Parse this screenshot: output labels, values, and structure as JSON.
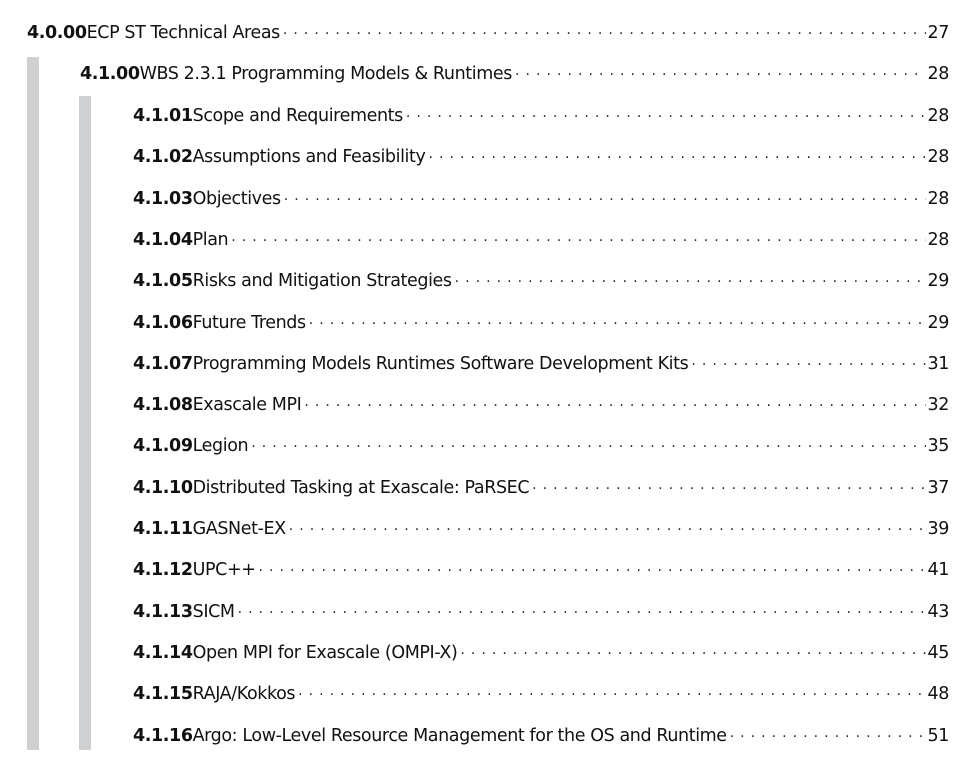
{
  "toc": {
    "level0": {
      "number": "4.0.00",
      "title": "ECP ST Technical Areas",
      "page": "27"
    },
    "level1": {
      "number": "4.1.00",
      "title": "WBS 2.3.1 Programming Models & Runtimes",
      "page": "28"
    },
    "entries": [
      {
        "number": "4.1.01",
        "title": "Scope and Requirements",
        "page": "28"
      },
      {
        "number": "4.1.02",
        "title": "Assumptions and Feasibility",
        "page": "28"
      },
      {
        "number": "4.1.03",
        "title": "Objectives",
        "page": "28"
      },
      {
        "number": "4.1.04",
        "title": "Plan",
        "page": "28"
      },
      {
        "number": "4.1.05",
        "title": "Risks and Mitigation Strategies",
        "page": "29"
      },
      {
        "number": "4.1.06",
        "title": "Future Trends",
        "page": "29"
      },
      {
        "number": "4.1.07",
        "title": "Programming Models Runtimes Software Development Kits",
        "page": "31"
      },
      {
        "number": "4.1.08",
        "title": "Exascale MPI",
        "page": "32"
      },
      {
        "number": "4.1.09",
        "title": "Legion",
        "page": "35"
      },
      {
        "number": "4.1.10",
        "title": "Distributed Tasking at Exascale: PaRSEC",
        "page": "37"
      },
      {
        "number": "4.1.11",
        "title": "GASNet-EX",
        "page": "39"
      },
      {
        "number": "4.1.12",
        "title": "UPC++",
        "page": "41"
      },
      {
        "number": "4.1.13",
        "title": "SICM",
        "page": "43"
      },
      {
        "number": "4.1.14",
        "title": "Open MPI for Exascale (OMPI-X)",
        "page": "45"
      },
      {
        "number": "4.1.15",
        "title": "RAJA/Kokkos",
        "page": "48"
      },
      {
        "number": "4.1.16",
        "title": "Argo: Low-Level Resource Management for the OS and Runtime",
        "page": "51"
      }
    ]
  }
}
